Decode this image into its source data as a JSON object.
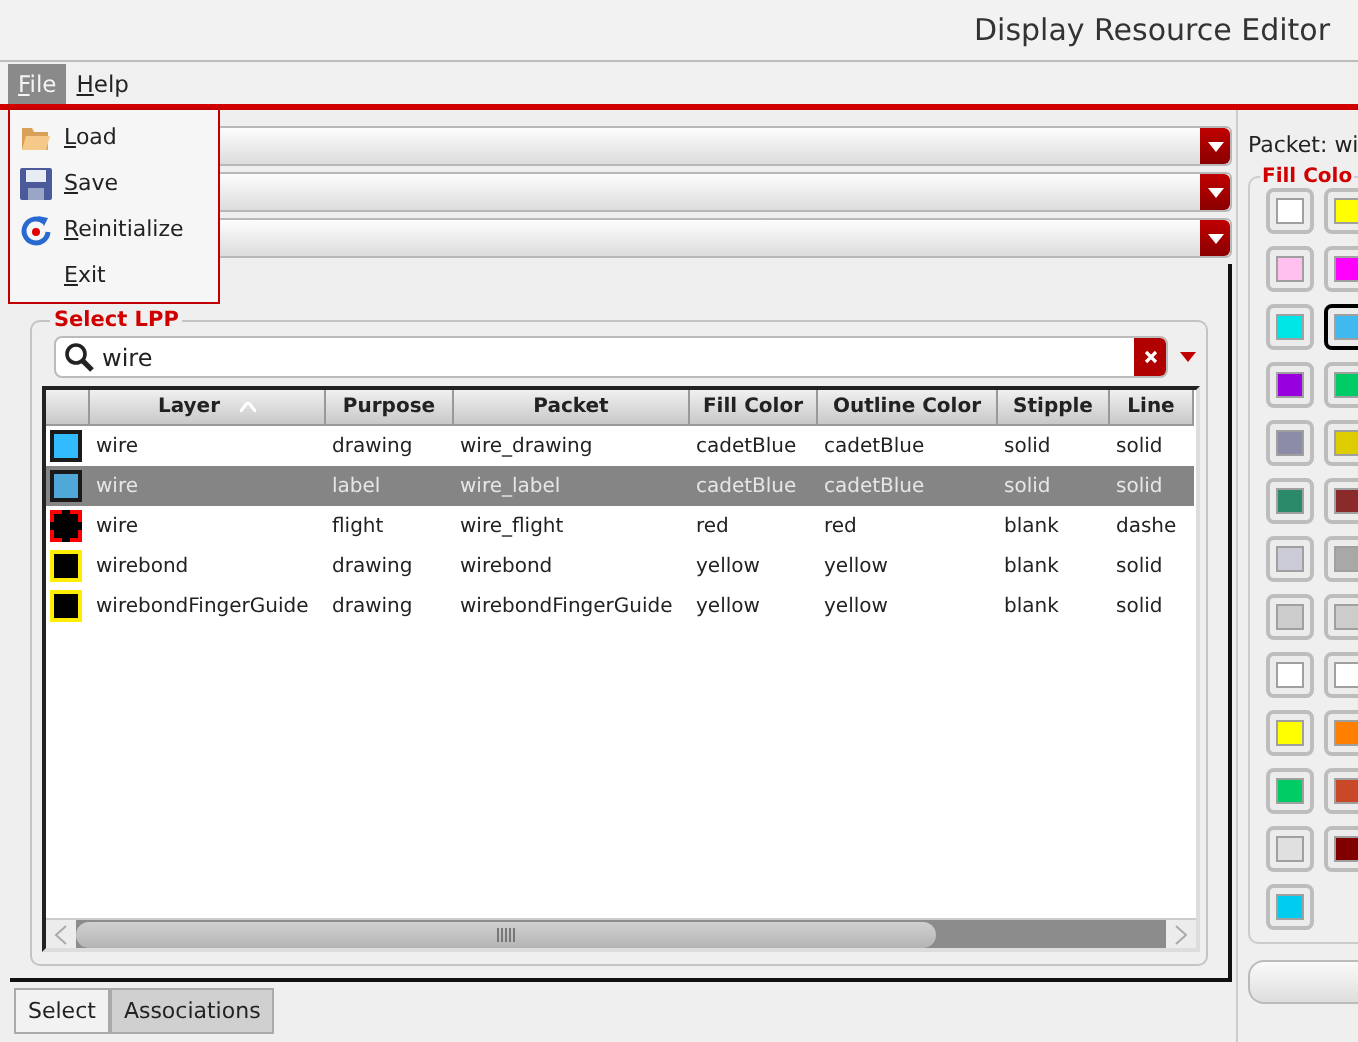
{
  "window": {
    "title": "Display Resource Editor"
  },
  "menu_bar": [
    {
      "label": "File",
      "selected": true
    },
    {
      "label": "Help",
      "selected": false
    }
  ],
  "file_menu": [
    {
      "label": "Load"
    },
    {
      "label": "Save"
    },
    {
      "label": "Reinitialize"
    },
    {
      "label": "Exit"
    }
  ],
  "select_lpp": {
    "title": "Select LPP",
    "search": {
      "value": "wire"
    },
    "table": {
      "columns": [
        {
          "label": "Layer",
          "sorted": true
        },
        {
          "label": "Purpose",
          "sorted": false
        },
        {
          "label": "Packet",
          "sorted": false
        },
        {
          "label": "Fill Color",
          "sorted": false
        },
        {
          "label": "Outline Color",
          "sorted": false
        },
        {
          "label": "Stipple",
          "sorted": false
        },
        {
          "label": "Line",
          "sorted": false
        }
      ],
      "rows": [
        {
          "selected": false,
          "swatch": {
            "fill": {
              "color": "#33bbff"
            },
            "outline": {
              "color": "#1a1a1a",
              "dashed": false
            }
          },
          "cells": [
            "wire",
            "drawing",
            "wire_drawing",
            "cadetBlue",
            "cadetBlue",
            "solid",
            "solid"
          ]
        },
        {
          "selected": true,
          "swatch": {
            "fill": {
              "color": "#4fa8d8"
            },
            "outline": {
              "color": "#1a1a1a",
              "dashed": false
            }
          },
          "cells": [
            "wire",
            "label",
            "wire_label",
            "cadetBlue",
            "cadetBlue",
            "solid",
            "solid"
          ]
        },
        {
          "selected": false,
          "swatch": {
            "fill": {
              "color": "#000000"
            },
            "outline": {
              "color": "#ff0000",
              "dashed": true
            }
          },
          "cells": [
            "wire",
            "flight",
            "wire_flight",
            "red",
            "red",
            "blank",
            "dashe"
          ]
        },
        {
          "selected": false,
          "swatch": {
            "fill": {
              "color": "#000000"
            },
            "outline": {
              "color": "#ffee00",
              "dashed": false
            }
          },
          "cells": [
            "wirebond",
            "drawing",
            "wirebond",
            "yellow",
            "yellow",
            "blank",
            "solid"
          ]
        },
        {
          "selected": false,
          "swatch": {
            "fill": {
              "color": "#000000"
            },
            "outline": {
              "color": "#ffee00",
              "dashed": false
            }
          },
          "cells": [
            "wirebondFingerGuide",
            "drawing",
            "wirebondFingerGuide",
            "yellow",
            "yellow",
            "blank",
            "solid"
          ]
        }
      ]
    }
  },
  "bottom_tabs": [
    {
      "label": "Select",
      "selected": true
    },
    {
      "label": "Associations",
      "selected": false
    }
  ],
  "packet_panel": {
    "label": "Packet: wi",
    "fill_color_title": "Fill Colo",
    "swatches": [
      {
        "color": "#ffffff",
        "selected": false
      },
      {
        "color": "#ffff00",
        "selected": false
      },
      {
        "color": "#ffc0f0",
        "selected": false
      },
      {
        "color": "#ff00ff",
        "selected": false
      },
      {
        "color": "#00e5e5",
        "selected": false
      },
      {
        "color": "#40b8f0",
        "selected": true
      },
      {
        "color": "#9900e0",
        "selected": false
      },
      {
        "color": "#00cc66",
        "selected": false
      },
      {
        "color": "#8c8ca8",
        "selected": false
      },
      {
        "color": "#ddcc00",
        "selected": false
      },
      {
        "color": "#2a8a6a",
        "selected": false
      },
      {
        "color": "#8a2a2a",
        "selected": false
      },
      {
        "color": "#ccccd8",
        "selected": false
      },
      {
        "color": "#a8a8a8",
        "selected": false
      },
      {
        "color": "#cccccc",
        "selected": false
      },
      {
        "color": "#cccccc",
        "selected": false
      },
      {
        "color": "#ffffff",
        "selected": false
      },
      {
        "color": "#ffffff",
        "selected": false
      },
      {
        "color": "#ffff00",
        "selected": false
      },
      {
        "color": "#ff7f00",
        "selected": false
      },
      {
        "color": "#00cc66",
        "selected": false
      },
      {
        "color": "#c84828",
        "selected": false
      },
      {
        "color": "#e0e0e0",
        "selected": false
      },
      {
        "color": "#800000",
        "selected": false
      },
      {
        "color": "#00ccf0",
        "selected": false
      }
    ]
  }
}
